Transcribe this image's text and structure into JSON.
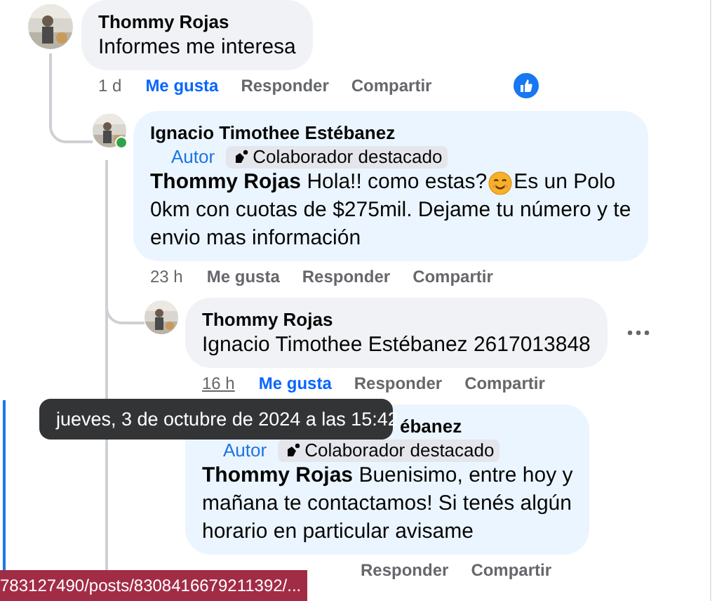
{
  "comments": [
    {
      "author": "Thommy Rojas",
      "body": [
        {
          "kind": "text",
          "lines": [
            "Informes me interesa"
          ]
        }
      ],
      "time": "1 d",
      "like_label": "Me gusta",
      "liked": true,
      "reply_label": "Responder",
      "share_label": "Compartir",
      "like_reaction": true,
      "children": [
        {
          "author": "Ignacio Timothee Estébanez",
          "online": true,
          "badges": [
            {
              "kind": "role",
              "label": "Autor"
            },
            {
              "kind": "featured",
              "label": "Colaborador destacado"
            }
          ],
          "body": [
            {
              "kind": "text",
              "lines": [
                "**Thommy Rojas** Hola!! como estas?"
              ]
            },
            {
              "kind": "emoji"
            },
            {
              "kind": "text",
              "lines": [
                "Es un Polo",
                "0km con cuotas de $275mil. Dejame tu número y te",
                "envio mas información"
              ]
            }
          ],
          "time": "23 h",
          "time_hovered": false,
          "like_label": "Me gusta",
          "liked": false,
          "reply_label": "Responder",
          "share_label": "Compartir",
          "children": [
            {
              "author": "Thommy Rojas",
              "body": [
                {
                  "kind": "text",
                  "lines": [
                    "Ignacio Timothee Estébanez 2617013848"
                  ]
                }
              ],
              "time": "16 h",
              "time_hovered": true,
              "like_label": "Me gusta",
              "liked": true,
              "reply_label": "Responder",
              "share_label": "Compartir",
              "menu_visible": true
            },
            {
              "author": "ébanez",
              "avatar_covered": true,
              "badges": [
                {
                  "kind": "role",
                  "label": "Autor"
                },
                {
                  "kind": "featured",
                  "label": "Colaborador destacado"
                }
              ],
              "body": [
                {
                  "kind": "text",
                  "lines": [
                    "**Thommy Rojas** Buenisimo, entre hoy y",
                    "mañana te contactamos! Si tenés algún",
                    "horario en particular avisame"
                  ]
                }
              ],
              "reply_label": "Responder",
              "share_label": "Compartir"
            }
          ]
        }
      ]
    }
  ],
  "tooltip": "jueves, 3 de octubre de 2024 a las 15:42",
  "status_bar": "783127490/posts/8308416679211392/..."
}
